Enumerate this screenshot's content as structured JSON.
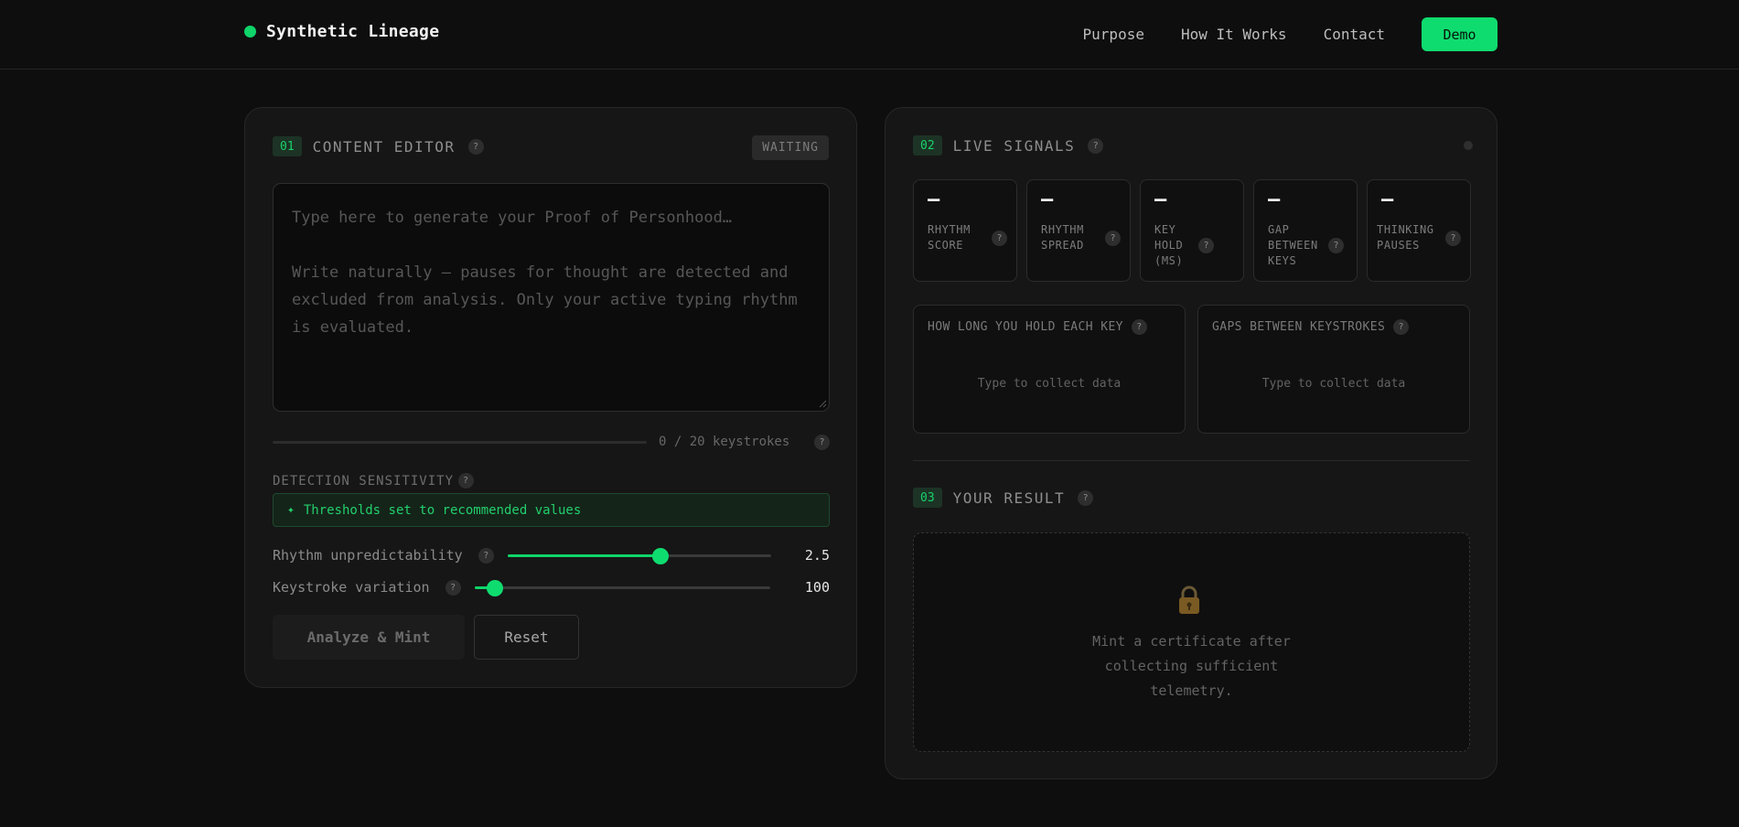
{
  "header": {
    "brand": "Synthetic Lineage",
    "nav": [
      "Purpose",
      "How It Works",
      "Contact"
    ],
    "demo_label": "Demo",
    "accent_color": "#0fdc6f"
  },
  "editor_panel": {
    "num": "01",
    "title": "CONTENT EDITOR",
    "help": "?",
    "status": "WAITING",
    "placeholder": "Type here to generate your Proof of Personhood…\n\nWrite naturally — pauses for thought are detected and excluded from analysis. Only your active typing rhythm is evaluated.",
    "keystrokes": {
      "count": 0,
      "target": 20,
      "text": "0 / 20 keystrokes",
      "progress_fraction": 0
    },
    "sensitivity": {
      "label": "DETECTION SENSITIVITY",
      "notice": "Thresholds set to recommended values",
      "notice_icon": "sparkle-icon",
      "sliders": [
        {
          "label": "Rhythm unpredictability",
          "value": "2.5",
          "fraction": 0.58
        },
        {
          "label": "Keystroke variation",
          "value": "100",
          "fraction": 0.07
        }
      ]
    },
    "analyze_label": "Analyze & Mint",
    "reset_label": "Reset"
  },
  "signals_panel": {
    "num": "02",
    "title": "LIVE SIGNALS",
    "metrics": [
      {
        "value": "—",
        "label": "RHYTHM SCORE"
      },
      {
        "value": "—",
        "label": "RHYTHM SPREAD"
      },
      {
        "value": "—",
        "label": "KEY HOLD (MS)"
      },
      {
        "value": "—",
        "label": "GAP BETWEEN KEYS"
      },
      {
        "value": "—",
        "label": "THINKING PAUSES"
      }
    ],
    "charts": [
      {
        "title": "HOW LONG YOU HOLD EACH KEY",
        "empty": "Type to collect data"
      },
      {
        "title": "GAPS BETWEEN KEYSTROKES",
        "empty": "Type to collect data"
      }
    ]
  },
  "result_panel": {
    "num": "03",
    "title": "YOUR RESULT",
    "icon": "lock-icon",
    "message": "Mint a certificate after collecting sufficient telemetry."
  }
}
